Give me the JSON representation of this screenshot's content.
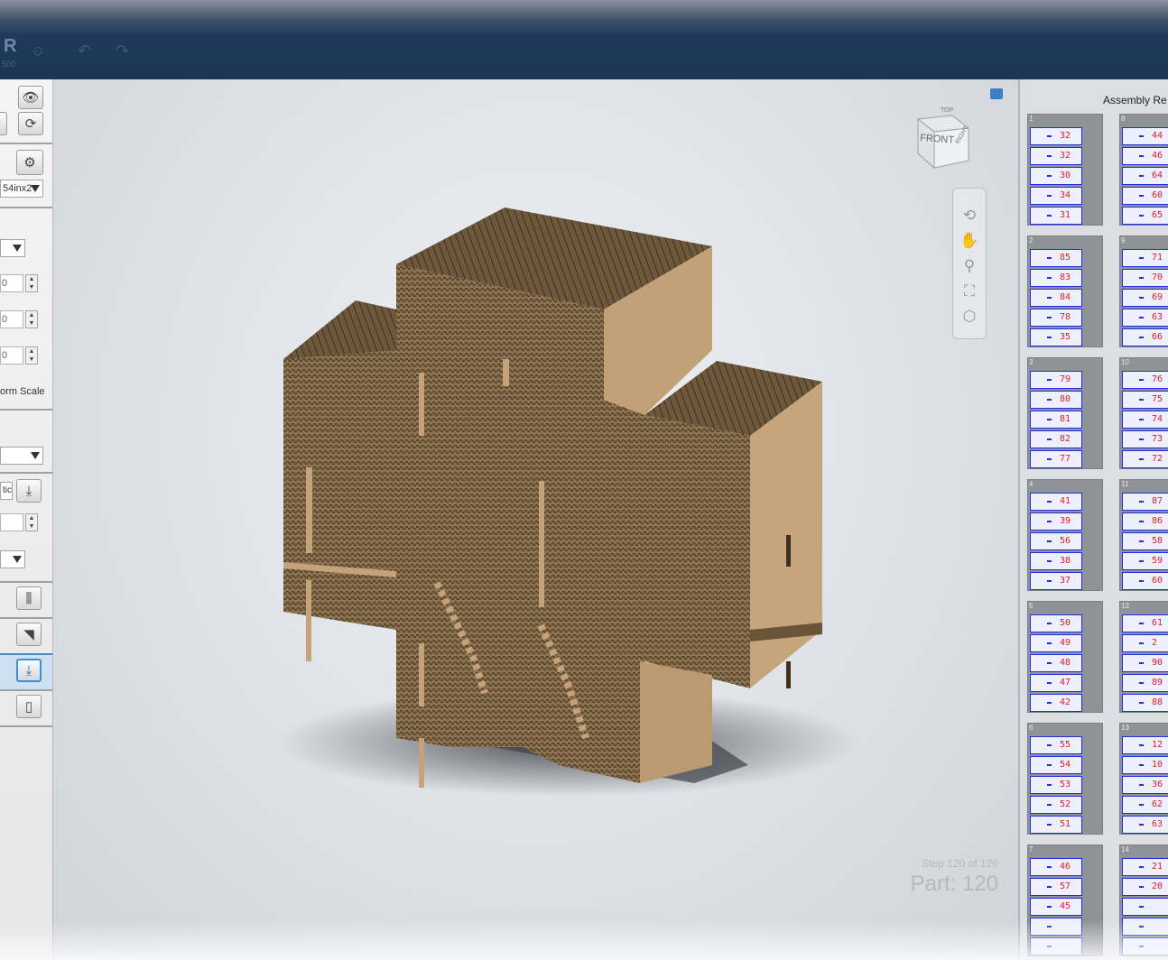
{
  "app": {
    "logo": "R",
    "logo_sub": "500"
  },
  "toolbar": {
    "undo_icon": "undo-icon",
    "redo_icon": "redo-icon"
  },
  "left_panel": {
    "sheet_size": "54inx2",
    "dim1": "0",
    "dim2": "0",
    "dim3": "0",
    "uniform_scale_label": "orm Scale",
    "construction_partial": "tic"
  },
  "viewport": {
    "viewcube_front": "FRONT",
    "viewcube_top": "TOP",
    "viewcube_right": "RIGHT",
    "step_text": "Step 120 of 120",
    "part_text": "Part: 120",
    "colors": {
      "cardboard": "#8c7350",
      "cardboard_dark": "#5a4630",
      "cardboard_side": "#c4a27a"
    }
  },
  "assembly": {
    "title": "Assembly Re",
    "sheets": [
      {
        "num": "1",
        "pieces": [
          "32",
          "32",
          "30",
          "34",
          "31"
        ]
      },
      {
        "num": "8",
        "pieces": [
          "44",
          "46",
          "64",
          "60",
          "65"
        ]
      },
      {
        "num": "2",
        "pieces": [
          "85",
          "83",
          "84",
          "78",
          "35"
        ]
      },
      {
        "num": "9",
        "pieces": [
          "71",
          "70",
          "69",
          "63",
          "66"
        ]
      },
      {
        "num": "3",
        "pieces": [
          "79",
          "80",
          "81",
          "82",
          "77"
        ]
      },
      {
        "num": "10",
        "pieces": [
          "76",
          "75",
          "74",
          "73",
          "72"
        ]
      },
      {
        "num": "4",
        "pieces": [
          "41",
          "39",
          "56",
          "38",
          "37"
        ]
      },
      {
        "num": "11",
        "pieces": [
          "87",
          "86",
          "58",
          "59",
          "60"
        ]
      },
      {
        "num": "5",
        "pieces": [
          "50",
          "49",
          "48",
          "47",
          "42"
        ]
      },
      {
        "num": "12",
        "pieces": [
          "61",
          "2",
          "90",
          "89",
          "88"
        ]
      },
      {
        "num": "6",
        "pieces": [
          "55",
          "54",
          "53",
          "52",
          "51"
        ]
      },
      {
        "num": "13",
        "pieces": [
          "12",
          "10",
          "36",
          "62",
          "63"
        ]
      },
      {
        "num": "7",
        "pieces": [
          "46",
          "57",
          "45",
          "",
          ""
        ]
      },
      {
        "num": "14",
        "pieces": [
          "21",
          "20",
          "",
          "",
          ""
        ]
      }
    ]
  }
}
